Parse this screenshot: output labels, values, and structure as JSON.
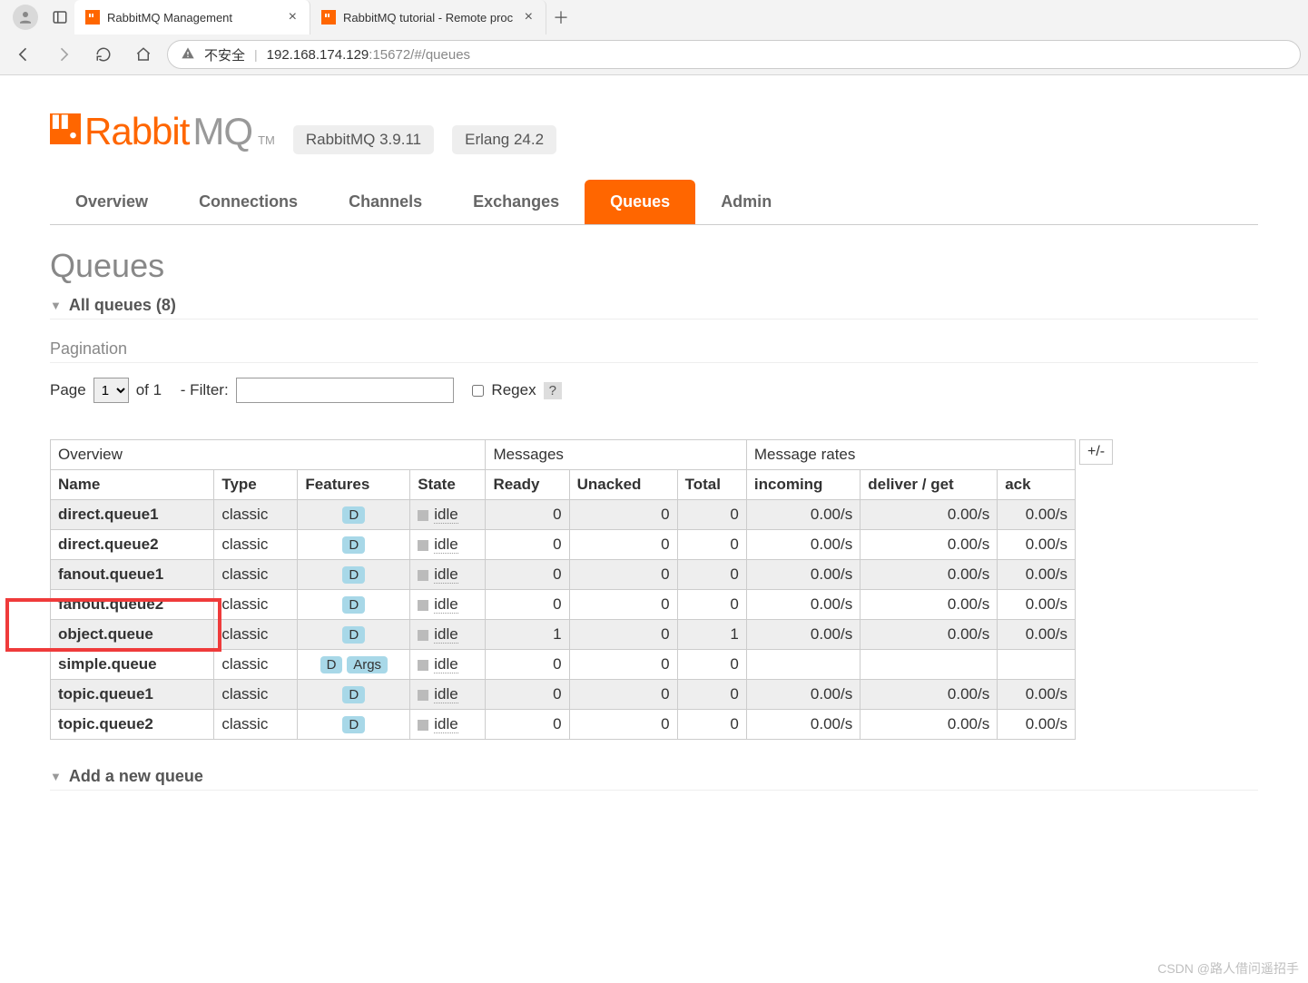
{
  "browser": {
    "tabs": [
      {
        "title": "RabbitMQ Management",
        "active": true
      },
      {
        "title": "RabbitMQ tutorial - Remote proc",
        "active": false
      }
    ],
    "insecure_label": "不安全",
    "url_prefix": "192.168.174.129",
    "url_suffix": ":15672/#/queues"
  },
  "logo": {
    "part1": "Rabbit",
    "part2": "MQ",
    "tm": "TM"
  },
  "versions": {
    "rabbit": "RabbitMQ 3.9.11",
    "erlang": "Erlang 24.2"
  },
  "navtabs": [
    "Overview",
    "Connections",
    "Channels",
    "Exchanges",
    "Queues",
    "Admin"
  ],
  "active_tab": "Queues",
  "page_title": "Queues",
  "all_queues_label": "All queues (8)",
  "pagination_label": "Pagination",
  "pager": {
    "page_label": "Page",
    "of_label": "of 1",
    "filter_label": "- Filter:",
    "regex_label": "Regex",
    "help": "?",
    "page_value": "1"
  },
  "table": {
    "groups": {
      "overview": "Overview",
      "messages": "Messages",
      "rates": "Message rates",
      "toggle": "+/-"
    },
    "cols": {
      "name": "Name",
      "type": "Type",
      "features": "Features",
      "state": "State",
      "ready": "Ready",
      "unacked": "Unacked",
      "total": "Total",
      "incoming": "incoming",
      "deliver": "deliver / get",
      "ack": "ack"
    },
    "rows": [
      {
        "name": "direct.queue1",
        "type": "classic",
        "features": [
          "D"
        ],
        "state": "idle",
        "ready": "0",
        "unacked": "0",
        "total": "0",
        "incoming": "0.00/s",
        "deliver": "0.00/s",
        "ack": "0.00/s"
      },
      {
        "name": "direct.queue2",
        "type": "classic",
        "features": [
          "D"
        ],
        "state": "idle",
        "ready": "0",
        "unacked": "0",
        "total": "0",
        "incoming": "0.00/s",
        "deliver": "0.00/s",
        "ack": "0.00/s"
      },
      {
        "name": "fanout.queue1",
        "type": "classic",
        "features": [
          "D"
        ],
        "state": "idle",
        "ready": "0",
        "unacked": "0",
        "total": "0",
        "incoming": "0.00/s",
        "deliver": "0.00/s",
        "ack": "0.00/s"
      },
      {
        "name": "fanout.queue2",
        "type": "classic",
        "features": [
          "D"
        ],
        "state": "idle",
        "ready": "0",
        "unacked": "0",
        "total": "0",
        "incoming": "0.00/s",
        "deliver": "0.00/s",
        "ack": "0.00/s"
      },
      {
        "name": "object.queue",
        "type": "classic",
        "features": [
          "D"
        ],
        "state": "idle",
        "ready": "1",
        "unacked": "0",
        "total": "1",
        "incoming": "0.00/s",
        "deliver": "0.00/s",
        "ack": "0.00/s",
        "highlight": true
      },
      {
        "name": "simple.queue",
        "type": "classic",
        "features": [
          "D",
          "Args"
        ],
        "state": "idle",
        "ready": "0",
        "unacked": "0",
        "total": "0",
        "incoming": "",
        "deliver": "",
        "ack": ""
      },
      {
        "name": "topic.queue1",
        "type": "classic",
        "features": [
          "D"
        ],
        "state": "idle",
        "ready": "0",
        "unacked": "0",
        "total": "0",
        "incoming": "0.00/s",
        "deliver": "0.00/s",
        "ack": "0.00/s"
      },
      {
        "name": "topic.queue2",
        "type": "classic",
        "features": [
          "D"
        ],
        "state": "idle",
        "ready": "0",
        "unacked": "0",
        "total": "0",
        "incoming": "0.00/s",
        "deliver": "0.00/s",
        "ack": "0.00/s"
      }
    ]
  },
  "add_new_label": "Add a new queue",
  "watermark": "CSDN @路人借问遥招手"
}
